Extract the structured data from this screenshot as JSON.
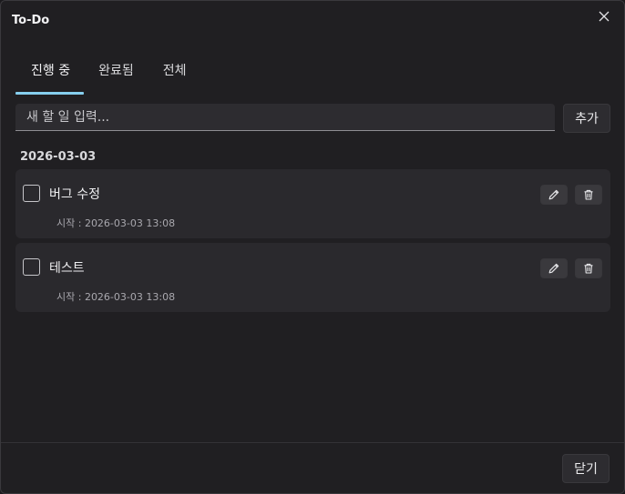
{
  "window": {
    "title": "To-Do",
    "close_icon": "close-icon"
  },
  "tabs": [
    {
      "label": "진행 중",
      "active": true
    },
    {
      "label": "완료됨",
      "active": false
    },
    {
      "label": "전체",
      "active": false
    }
  ],
  "new_task": {
    "placeholder": "새 할 일 입력...",
    "value": "",
    "add_label": "추가"
  },
  "groups": [
    {
      "date": "2026-03-03",
      "items": [
        {
          "title": "버그 수정",
          "meta": "시작 : 2026-03-03 13:08",
          "done": false
        },
        {
          "title": "테스트",
          "meta": "시작 : 2026-03-03 13:08",
          "done": false
        }
      ]
    }
  ],
  "icons": {
    "edit": "pencil-icon",
    "delete": "trash-icon"
  },
  "footer": {
    "close_label": "닫기"
  },
  "colors": {
    "accent": "#86cfee",
    "background": "#201f22",
    "card": "#2a292d"
  }
}
